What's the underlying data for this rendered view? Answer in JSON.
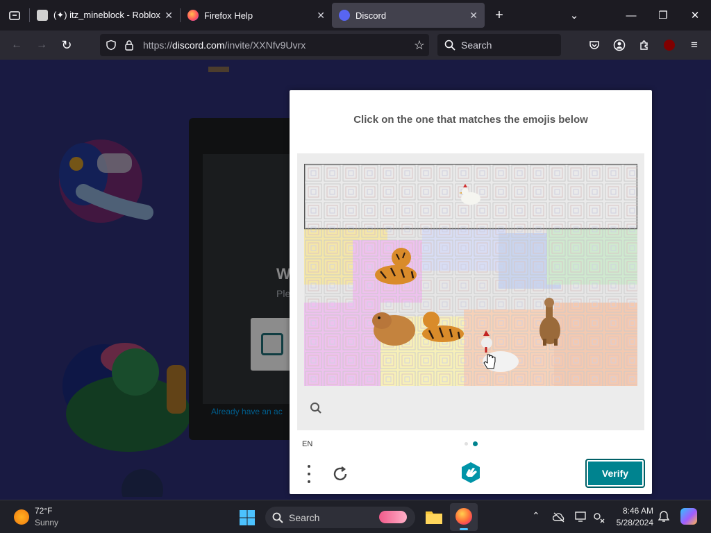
{
  "browser": {
    "tabs": [
      {
        "title": "(✦) itz_mineblock - Roblox",
        "active": false
      },
      {
        "title": "Firefox Help",
        "active": false
      },
      {
        "title": "Discord",
        "active": true
      }
    ],
    "url_prefix": "https://",
    "url_host": "discord.com",
    "url_path": "/invite/XXNfv9Uvrx",
    "search_placeholder": "Search"
  },
  "page": {
    "heading_fragment": "W",
    "sub_fragment": "Ple",
    "link_fragment": "Already have an ac"
  },
  "captcha": {
    "prompt": "Click on the one that matches the emojis below",
    "language": "EN",
    "verify_label": "Verify",
    "emoji_row": [
      "chicken"
    ],
    "image_items": [
      "tiger",
      "capybara",
      "tiger",
      "chicken",
      "alpaca"
    ]
  },
  "taskbar": {
    "weather_temp": "72°F",
    "weather_desc": "Sunny",
    "search_label": "Search",
    "time": "8:46 AM",
    "date": "5/28/2024"
  }
}
